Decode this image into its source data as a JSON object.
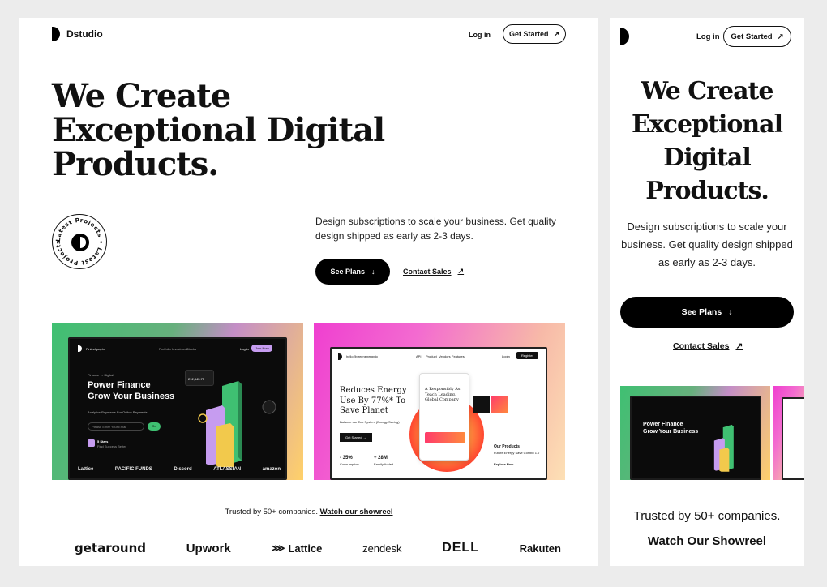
{
  "brand": {
    "name": "Dstudio"
  },
  "nav": {
    "login": "Log in",
    "cta": "Get Started",
    "cta_icon": "arrow-up-right-icon"
  },
  "hero": {
    "title_lines": [
      "We Create",
      "Exceptional Digital",
      "Products."
    ],
    "mobile_title_lines": [
      "We Create",
      "Exceptional",
      "Digital",
      "Products."
    ],
    "subtitle": "Design subscriptions to scale your business. Get quality design shipped as early as 2-3 days.",
    "primary_cta": "See Plans",
    "secondary_cta": "Contact Sales",
    "badge_text": "Latest Projects • Latest Projects •"
  },
  "showcase": {
    "finance": {
      "brand": "Fintechpay.io",
      "nav": [
        "Portfolio",
        "Investment",
        "Stocks"
      ],
      "login": "Log in",
      "join": "Join Now",
      "breadcrumb": "Finance → Digital",
      "title_lines": [
        "Power Finance",
        "Grow Your Business"
      ],
      "sub": "Analytics Payments For Online Payments",
      "input_placeholder": "Please Enter Your Email",
      "go": "Go",
      "stat_value": "212,845.75",
      "rating": "5 Stars",
      "rating_sub": "Find Success Better",
      "logos": [
        "Lattice",
        "PACIFIC FUNDS",
        "Discord",
        "ATLASSIAN",
        "amazon"
      ]
    },
    "energy": {
      "email": "hello@greenenergy.io",
      "nav": [
        "API",
        "Product",
        "Vendors",
        "Features"
      ],
      "login": "Login",
      "register": "Register",
      "title_lines": [
        "Reduces Energy",
        "Use By 77%* To",
        "Save Planet"
      ],
      "sub": "Balance our Eco System (Energy Saving)",
      "cta": "Get Started →",
      "stats": [
        {
          "value": "- 35%",
          "label": "Consumption"
        },
        {
          "value": "+ 28M",
          "label": "Family Added"
        }
      ],
      "card_title_lines": [
        "A Responsibly As",
        "Teach Leading,",
        "Global Company"
      ],
      "products_title": "Our Products",
      "products_sub": "Future Energy Save Combo 1.0",
      "explore": "Explore Now"
    }
  },
  "trusted": {
    "text": "Trusted by 50+ companies.",
    "link": "Watch our showreel",
    "mobile_link": "Watch Our Showreel"
  },
  "company_logos": [
    "getaround",
    "Upwork",
    "Lattice",
    "zendesk",
    "DELL",
    "Rakuten"
  ]
}
